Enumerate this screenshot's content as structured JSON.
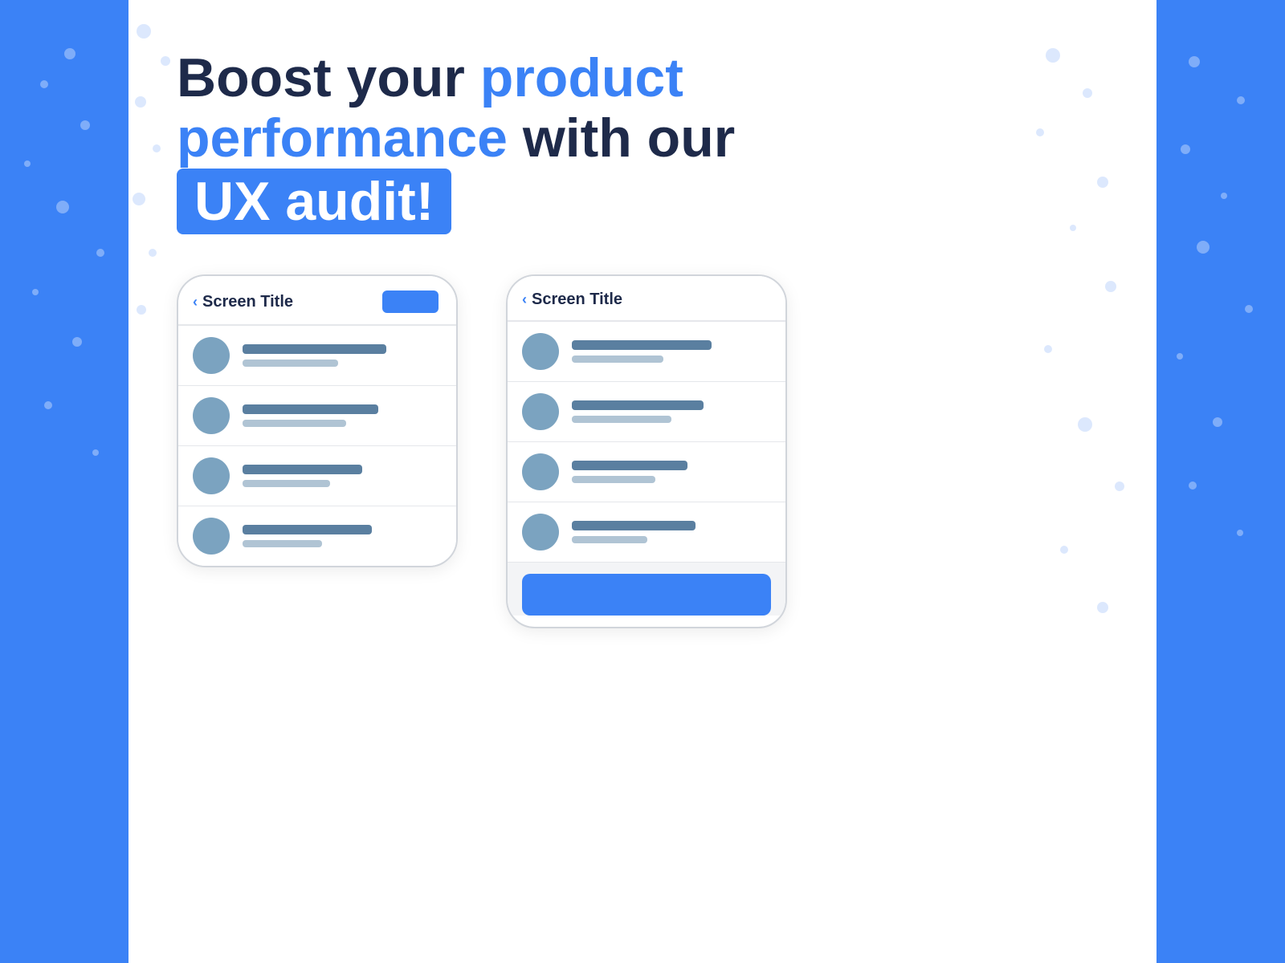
{
  "headline": {
    "part1": "Boost your ",
    "highlight": "product\nperformance",
    "part2": " with our",
    "badge": "UX audit!"
  },
  "phone1": {
    "back_arrow": "‹",
    "title": "Screen Title",
    "has_header_button": true,
    "items": [
      {
        "line1_width": "72%",
        "line2_width": "48%"
      },
      {
        "line1_width": "68%",
        "line2_width": "52%"
      },
      {
        "line1_width": "60%",
        "line2_width": "44%"
      },
      {
        "line1_width": "65%",
        "line2_width": "40%"
      }
    ]
  },
  "phone2": {
    "back_arrow": "‹",
    "title": "Screen Title",
    "has_header_button": false,
    "has_bottom_button": true,
    "items": [
      {
        "line1_width": "70%",
        "line2_width": "46%"
      },
      {
        "line1_width": "66%",
        "line2_width": "50%"
      },
      {
        "line1_width": "58%",
        "line2_width": "42%"
      },
      {
        "line1_width": "62%",
        "line2_width": "38%"
      }
    ]
  },
  "colors": {
    "blue": "#3b82f6",
    "dark_navy": "#1e2a4a",
    "white": "#ffffff"
  }
}
